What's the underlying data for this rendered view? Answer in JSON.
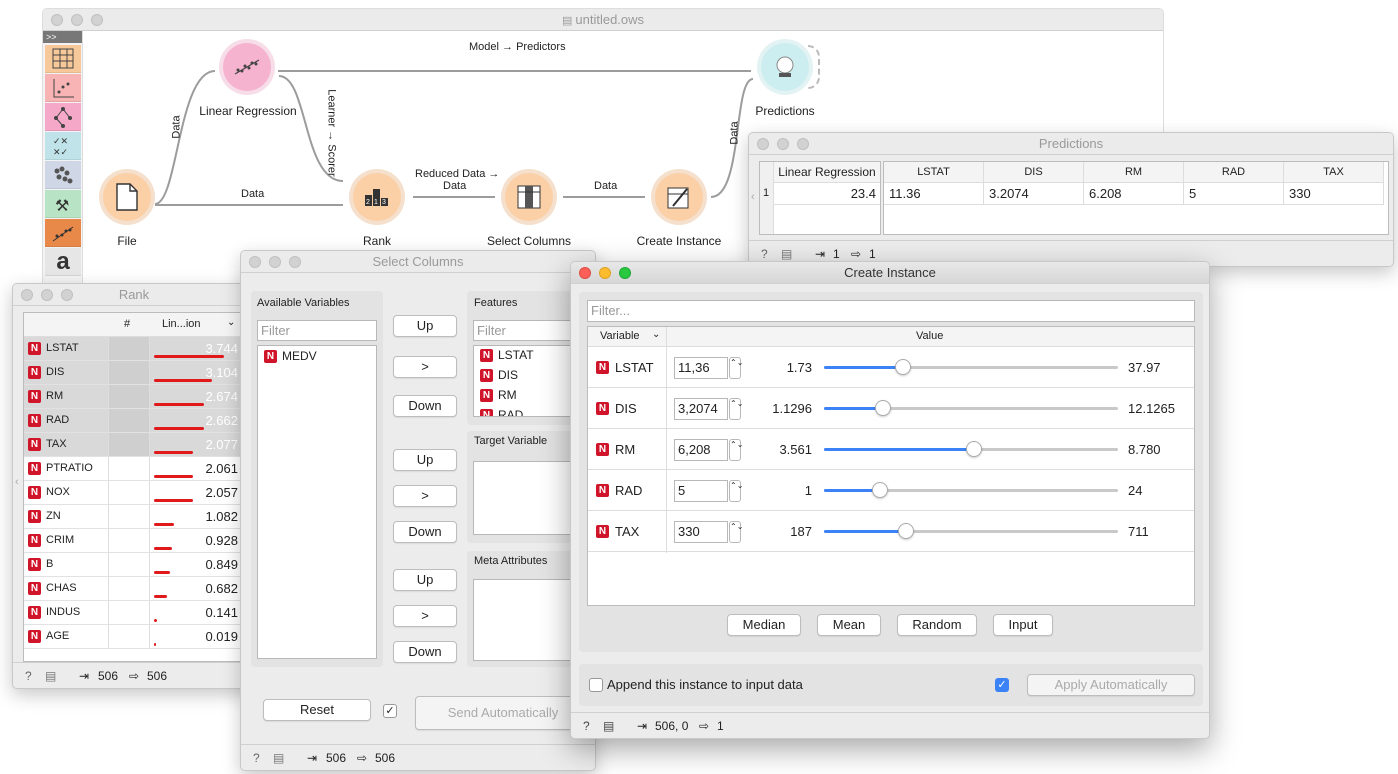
{
  "canvas": {
    "title": "untitled.ows",
    "nodes": {
      "file": "File",
      "lr": "Linear Regression",
      "rank": "Rank",
      "select": "Select Columns",
      "create": "Create Instance",
      "pred": "Predictions"
    },
    "links": {
      "model": "Model → Predictors",
      "data1": "Data",
      "data2": "Data",
      "learner": "Learner → Scorer",
      "reduced1": "Reduced Data →",
      "reduced2": "Data",
      "data3": "Data",
      "data4": "Data"
    },
    "toolbox_top": ">>"
  },
  "predictions": {
    "title": "Predictions",
    "row_num": "1",
    "model_header": "Linear Regression",
    "model_value": "23.4",
    "columns": [
      "LSTAT",
      "DIS",
      "RM",
      "RAD",
      "TAX"
    ],
    "values": [
      "11.36",
      "3.2074",
      "6.208",
      "5",
      "330"
    ],
    "status": {
      "in": "1",
      "out": "1"
    }
  },
  "rank": {
    "title": "Rank",
    "col_num": "#",
    "col_score": "Lin...ion",
    "rows": [
      {
        "name": "LSTAT",
        "score": "3.744",
        "frac": 1.0
      },
      {
        "name": "DIS",
        "score": "3.104",
        "frac": 0.83
      },
      {
        "name": "RM",
        "score": "2.674",
        "frac": 0.71
      },
      {
        "name": "RAD",
        "score": "2.662",
        "frac": 0.71
      },
      {
        "name": "TAX",
        "score": "2.077",
        "frac": 0.55
      },
      {
        "name": "PTRATIO",
        "score": "2.061",
        "frac": 0.55
      },
      {
        "name": "NOX",
        "score": "2.057",
        "frac": 0.55
      },
      {
        "name": "ZN",
        "score": "1.082",
        "frac": 0.29
      },
      {
        "name": "CRIM",
        "score": "0.928",
        "frac": 0.25
      },
      {
        "name": "B",
        "score": "0.849",
        "frac": 0.23
      },
      {
        "name": "CHAS",
        "score": "0.682",
        "frac": 0.18
      },
      {
        "name": "INDUS",
        "score": "0.141",
        "frac": 0.04
      },
      {
        "name": "AGE",
        "score": "0.019",
        "frac": 0.01
      }
    ],
    "status": {
      "in": "506",
      "out": "506"
    }
  },
  "select": {
    "title": "Select Columns",
    "available_label": "Available Variables",
    "filter": "Filter",
    "available": [
      "MEDV"
    ],
    "features_label": "Features",
    "features": [
      "LSTAT",
      "DIS",
      "RM",
      "RAD"
    ],
    "target_label": "Target Variable",
    "meta_label": "Meta Attributes",
    "up": "Up",
    ">": ">",
    "down": "Down",
    "reset": "Reset",
    "send": "Send Automatically",
    "status": {
      "in": "506",
      "out": "506"
    }
  },
  "create": {
    "title": "Create Instance",
    "filter": "Filter...",
    "col_variable": "Variable",
    "col_value": "Value",
    "rows": [
      {
        "name": "LSTAT",
        "value": "11,36",
        "min": "1.73",
        "max": "37.97",
        "frac": 0.27
      },
      {
        "name": "DIS",
        "value": "3,2074",
        "min": "1.1296",
        "max": "12.1265",
        "frac": 0.2
      },
      {
        "name": "RM",
        "value": "6,208",
        "min": "3.561",
        "max": "8.780",
        "frac": 0.51
      },
      {
        "name": "RAD",
        "value": "5",
        "min": "1",
        "max": "24",
        "frac": 0.19
      },
      {
        "name": "TAX",
        "value": "330",
        "min": "187",
        "max": "711",
        "frac": 0.28
      }
    ],
    "buttons": [
      "Median",
      "Mean",
      "Random",
      "Input"
    ],
    "append": "Append this instance to input data",
    "apply": "Apply Automatically",
    "status": {
      "in": "506, 0",
      "out": "1"
    }
  },
  "colors": {
    "accent": "#3b82f6",
    "badge": "#d0152a",
    "bar": "#e0191b"
  }
}
